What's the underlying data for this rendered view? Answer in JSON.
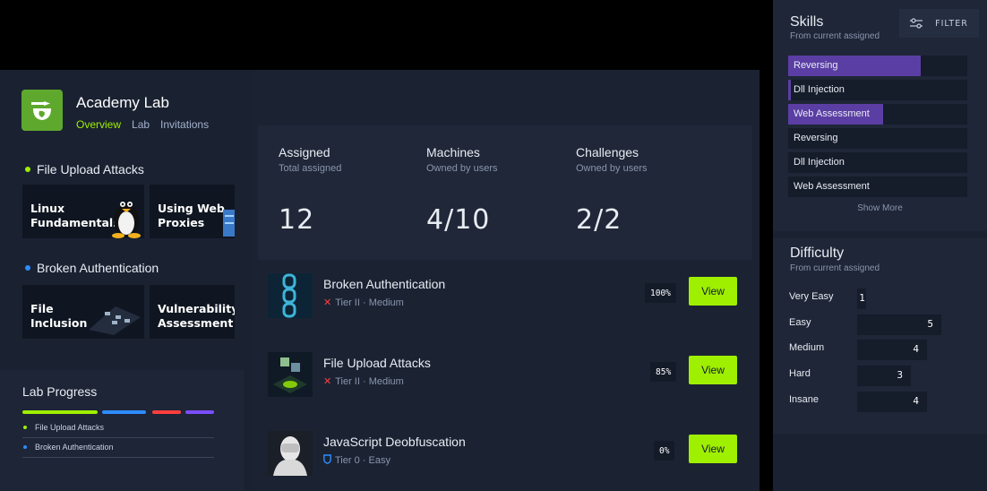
{
  "lab": {
    "title": "Academy Lab",
    "nav": [
      "Overview",
      "Lab",
      "Invitations"
    ],
    "active_nav": "Overview"
  },
  "paths": [
    {
      "title": "File Upload Attacks",
      "dot_color": "#9fef00",
      "tiles": [
        "Linux\nFundamentals",
        "Using Web\nProxies"
      ]
    },
    {
      "title": "Broken Authentication",
      "dot_color": "#2e8cff",
      "tiles": [
        "File\nInclusion",
        "Vulnerability\nAssessment"
      ]
    }
  ],
  "lab_progress": {
    "title": "Lab Progress",
    "bar_colors": [
      "#9fef00",
      "#2e8cff",
      "#ff3e3e",
      "#7c4dff"
    ],
    "items": [
      {
        "label": "File Upload Attacks",
        "dot_color": "#9fef00"
      },
      {
        "label": "Broken Authentication",
        "dot_color": "#2e8cff"
      }
    ]
  },
  "stats": [
    {
      "label": "Assigned",
      "sub": "Total assigned",
      "value": "12"
    },
    {
      "label": "Machines",
      "sub": "Owned by users",
      "value": "4/10"
    },
    {
      "label": "Challenges",
      "sub": "Owned by users",
      "value": "2/2"
    }
  ],
  "modules": [
    {
      "title": "Broken Authentication",
      "tier": "Tier II · Medium",
      "tier_icon": "x-icon",
      "progress": "100%",
      "button": "View"
    },
    {
      "title": "File Upload Attacks",
      "tier": "Tier II · Medium",
      "tier_icon": "x-icon",
      "progress": "85%",
      "button": "View"
    },
    {
      "title": "JavaScript Deobfuscation",
      "tier": "Tier 0 · Easy",
      "tier_icon": "shield-icon",
      "progress": "0%",
      "button": "View"
    }
  ],
  "skills": {
    "title": "Skills",
    "subtitle": "From current assigned",
    "filter_label": "FILTER",
    "items": [
      {
        "label": "Reversing",
        "level": 0.74
      },
      {
        "label": "Dll Injection",
        "level": 0.0
      },
      {
        "label": "Web Assessment",
        "level": 0.53
      },
      {
        "label": "Reversing",
        "level": 0.0
      },
      {
        "label": "Dll Injection",
        "level": 0.0
      },
      {
        "label": "Web Assessment",
        "level": 0.0
      }
    ],
    "show_more": "Show More"
  },
  "difficulty": {
    "title": "Difficulty",
    "subtitle": "From current assigned",
    "items": [
      {
        "label": "Very Easy",
        "count": "1"
      },
      {
        "label": "Easy",
        "count": "5"
      },
      {
        "label": "Medium",
        "count": "4"
      },
      {
        "label": "Hard",
        "count": "3"
      },
      {
        "label": "Insane",
        "count": "4"
      }
    ]
  },
  "colors": {
    "accent_green": "#9fef00",
    "skill_purple": "#5b3ea4",
    "panel": "#1a2232"
  }
}
